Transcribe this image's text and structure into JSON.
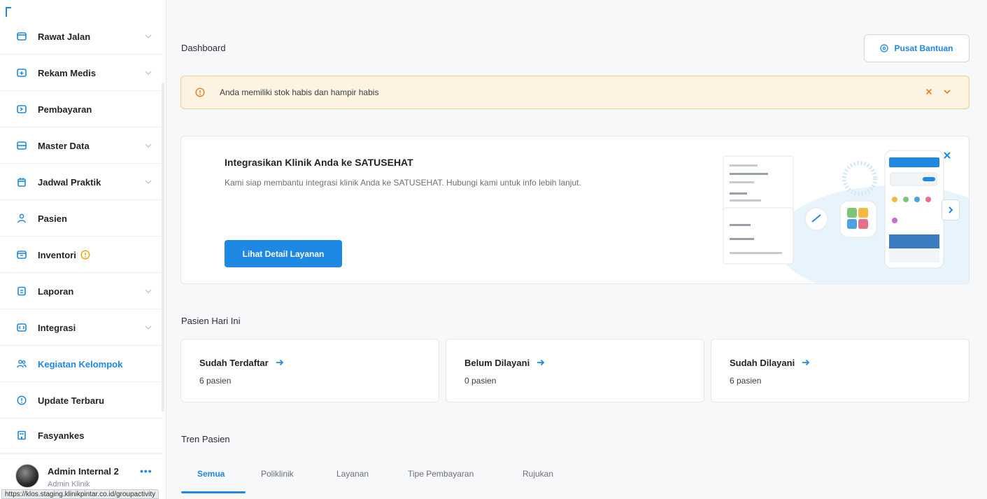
{
  "colors": {
    "accent": "#1e88e5",
    "warning": "#f59e0b",
    "alert_bg": "#fdf3e2",
    "close_orange": "#e8811a"
  },
  "sidebar": {
    "items": [
      {
        "label": "Rawat Jalan",
        "icon": "monitor-icon",
        "has_chevron": true
      },
      {
        "label": "Rekam Medis",
        "icon": "medical-folder-icon",
        "has_chevron": true
      },
      {
        "label": "Pembayaran",
        "icon": "payment-icon",
        "has_chevron": false
      },
      {
        "label": "Master Data",
        "icon": "database-icon",
        "has_chevron": true
      },
      {
        "label": "Jadwal Praktik",
        "icon": "calendar-icon",
        "has_chevron": true
      },
      {
        "label": "Pasien",
        "icon": "user-icon",
        "has_chevron": false
      },
      {
        "label": "Inventori",
        "icon": "inventory-icon",
        "has_chevron": false,
        "warning": true
      },
      {
        "label": "Laporan",
        "icon": "report-icon",
        "has_chevron": true
      },
      {
        "label": "Integrasi",
        "icon": "integration-icon",
        "has_chevron": true
      },
      {
        "label": "Kegiatan Kelompok",
        "icon": "group-icon",
        "has_chevron": false,
        "active": true
      },
      {
        "label": "Update Terbaru",
        "icon": "info-icon",
        "has_chevron": false
      },
      {
        "label": "Fasyankes",
        "icon": "building-icon",
        "has_chevron": false
      }
    ],
    "user": {
      "name": "Admin Internal 2",
      "role": "Admin Klinik",
      "more": "•••"
    }
  },
  "status_url": "https://klos.staging.klinikpintar.co.id/groupactivity",
  "header": {
    "title": "Dashboard",
    "help_label": "Pusat Bantuan"
  },
  "alert": {
    "text": "Anda memiliki stok habis dan hampir habis"
  },
  "promo": {
    "title": "Integrasikan Klinik Anda ke SATUSEHAT",
    "description": "Kami siap membantu integrasi klinik Anda ke SATUSEHAT. Hubungi kami untuk info lebih lanjut.",
    "button_label": "Lihat Detail Layanan"
  },
  "today": {
    "title": "Pasien Hari Ini",
    "cards": [
      {
        "title": "Sudah Terdaftar",
        "value": "6 pasien"
      },
      {
        "title": "Belum Dilayani",
        "value": "0 pasien"
      },
      {
        "title": "Sudah Dilayani",
        "value": "6 pasien"
      }
    ]
  },
  "trend": {
    "title": "Tren Pasien",
    "tabs": [
      "Semua",
      "Poliklinik",
      "Layanan",
      "Tipe Pembayaran",
      "Rujukan"
    ],
    "active_tab": "Semua"
  }
}
